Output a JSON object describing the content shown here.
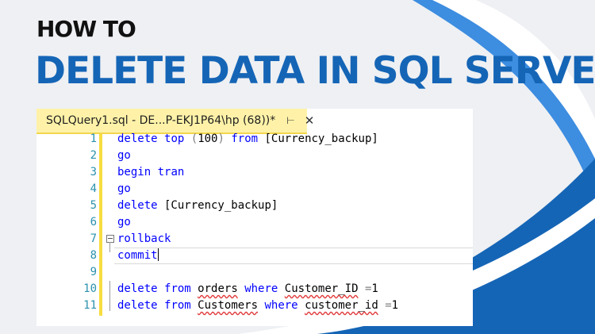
{
  "heading": {
    "small": "HOW TO",
    "big": "DELETE DATA IN SQL SERVER"
  },
  "colors": {
    "accent_blue": "#1565b6",
    "tab_yellow": "#fff2a8",
    "keyword": "#0000ff",
    "line_number": "#2b91af"
  },
  "editor": {
    "tab_title": "SQLQuery1.sql - DE...P-EKJ1P64\\hp (68))*",
    "pin_icon": "pin-icon",
    "close_icon": "close-icon",
    "lines": [
      {
        "n": "1",
        "parts": [
          [
            "kw",
            "delete"
          ],
          [
            "t",
            " "
          ],
          [
            "kw",
            "top"
          ],
          [
            "t",
            " "
          ],
          [
            "gr",
            "("
          ],
          [
            "t",
            "100"
          ],
          [
            "gr",
            ")"
          ],
          [
            "t",
            " "
          ],
          [
            "kw",
            "from"
          ],
          [
            "t",
            " [Currency_backup]"
          ]
        ]
      },
      {
        "n": "2",
        "parts": [
          [
            "kw",
            "go"
          ]
        ]
      },
      {
        "n": "3",
        "parts": [
          [
            "kw",
            "begin"
          ],
          [
            "t",
            " "
          ],
          [
            "kw",
            "tran"
          ]
        ]
      },
      {
        "n": "4",
        "parts": [
          [
            "kw",
            "go"
          ]
        ]
      },
      {
        "n": "5",
        "parts": [
          [
            "kw",
            "delete"
          ],
          [
            "t",
            " [Currency_backup]"
          ]
        ]
      },
      {
        "n": "6",
        "parts": [
          [
            "kw",
            "go"
          ]
        ]
      },
      {
        "n": "7",
        "parts": [
          [
            "kw",
            "rollback"
          ]
        ]
      },
      {
        "n": "8",
        "parts": [
          [
            "kw",
            "commit"
          ]
        ]
      },
      {
        "n": "9",
        "parts": []
      },
      {
        "n": "10",
        "parts": [
          [
            "kw",
            "delete"
          ],
          [
            "t",
            " "
          ],
          [
            "kw",
            "from"
          ],
          [
            "t",
            " "
          ],
          [
            "sq",
            "orders"
          ],
          [
            "t",
            " "
          ],
          [
            "kw",
            "where"
          ],
          [
            "t",
            " "
          ],
          [
            "sq",
            "Customer_ID"
          ],
          [
            "t",
            " "
          ],
          [
            "gr",
            "="
          ],
          [
            "t",
            "1"
          ]
        ]
      },
      {
        "n": "11",
        "parts": [
          [
            "kw",
            "delete"
          ],
          [
            "t",
            " "
          ],
          [
            "kw",
            "from"
          ],
          [
            "t",
            " "
          ],
          [
            "sq",
            "Customers"
          ],
          [
            "t",
            " "
          ],
          [
            "kw",
            "where"
          ],
          [
            "t",
            " "
          ],
          [
            "sq",
            "customer_id"
          ],
          [
            "t",
            " "
          ],
          [
            "gr",
            "="
          ],
          [
            "t",
            "1"
          ]
        ]
      }
    ]
  }
}
